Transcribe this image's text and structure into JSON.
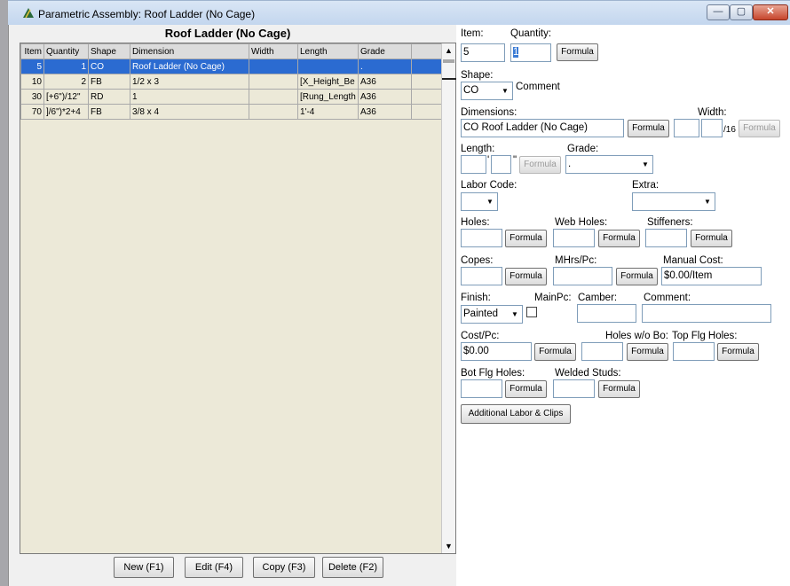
{
  "window": {
    "title": "Parametric Assembly: Roof Ladder (No Cage)",
    "controls": {
      "minimize": "—",
      "maximize": "▢",
      "close": "✕"
    }
  },
  "grid": {
    "title": "Roof Ladder (No Cage)",
    "columns": [
      "Item",
      "Quantity",
      "Shape",
      "Dimension",
      "Width",
      "Length",
      "Grade"
    ],
    "rows": [
      {
        "item": "5",
        "quantity": "1",
        "shape": "CO",
        "dimension": "Roof Ladder (No Cage)",
        "width": "",
        "length": "",
        "grade": "."
      },
      {
        "item": "10",
        "quantity": "2",
        "shape": "FB",
        "dimension": "1/2 x 3",
        "width": "",
        "length": "[X_Height_Be",
        "grade": "A36"
      },
      {
        "item": "30",
        "quantity": "[+6\")/12\"",
        "shape": "RD",
        "dimension": "1",
        "width": "",
        "length": "[Rung_Length",
        "grade": "A36"
      },
      {
        "item": "70",
        "quantity": "]/6\")*2+4",
        "shape": "FB",
        "dimension": "3/8 x 4",
        "width": "",
        "length": "1'-4",
        "grade": "A36"
      }
    ],
    "scroll": {
      "up": "▲",
      "down": "▼"
    }
  },
  "bottom_buttons": {
    "new": "New (F1)",
    "edit": "Edit (F4)",
    "copy": "Copy (F3)",
    "delete": "Delete (F2)"
  },
  "form": {
    "item_label": "Item:",
    "item_value": "5",
    "quantity_label": "Quantity:",
    "quantity_value": "1",
    "formula": "Formula",
    "shape_label": "Shape:",
    "shape_value": "CO",
    "comment_text": "Comment",
    "dimensions_label": "Dimensions:",
    "dimensions_value": "CO Roof Ladder (No Cage)",
    "width_label": "Width:",
    "width_unit": "/16",
    "length_label": "Length:",
    "length_feet_mark": "'",
    "length_inch_mark": "\"",
    "grade_label": "Grade:",
    "grade_value": ".",
    "labor_code_label": "Labor Code:",
    "extra_label": "Extra:",
    "holes_label": "Holes:",
    "web_holes_label": "Web Holes:",
    "stiffeners_label": "Stiffeners:",
    "copes_label": "Copes:",
    "mhrs_label": "MHrs/Pc:",
    "manual_cost_label": "Manual Cost:",
    "manual_cost_value": "$0.00/Item",
    "finish_label": "Finish:",
    "finish_value": "Painted",
    "mainpc_label": "MainPc:",
    "camber_label": "Camber:",
    "comment_label": "Comment:",
    "cost_label": "Cost/Pc:",
    "cost_value": "$0.00",
    "holes_wo_bo_label": "Holes w/o Bo:",
    "top_flg_label": "Top Flg Holes:",
    "bot_flg_label": "Bot Flg Holes:",
    "welded_studs_label": "Welded Studs:",
    "additional_labor_button": "Additional Labor & Clips",
    "dropdown_arrow": "▼"
  }
}
